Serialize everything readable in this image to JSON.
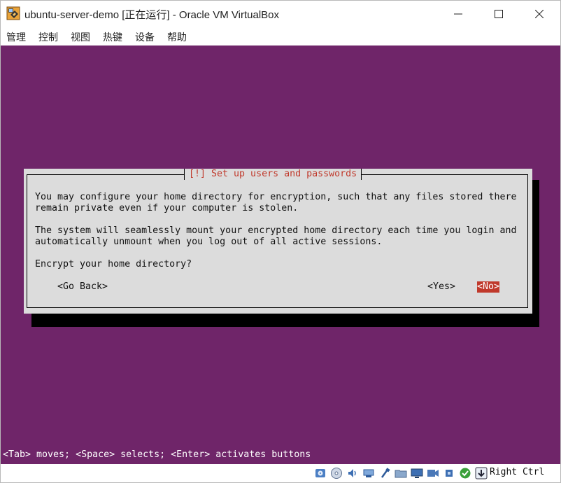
{
  "window": {
    "title": "ubuntu-server-demo [正在运行] - Oracle VM VirtualBox",
    "app_icon": "virtualbox-icon"
  },
  "menubar": {
    "items": [
      "管理",
      "控制",
      "视图",
      "热键",
      "设备",
      "帮助"
    ]
  },
  "installer": {
    "background_color": "#6f2569",
    "dialog_title": "[!] Set up users and passwords",
    "paragraph1_line1": "You may configure your home directory for encryption, such that any files stored there",
    "paragraph1_line2": "remain private even if your computer is stolen.",
    "paragraph2_line1": "The system will seamlessly mount your encrypted home directory each time you login and",
    "paragraph2_line2": "automatically unmount when you log out of all active sessions.",
    "question": "Encrypt your home directory?",
    "buttons": {
      "go_back": "<Go Back>",
      "yes": "<Yes>",
      "no": "<No>"
    },
    "selected_button": "no",
    "help_line": "<Tab> moves; <Space> selects; <Enter> activates buttons"
  },
  "statusbar": {
    "icons": [
      "hard-disk-icon",
      "optical-drive-icon",
      "audio-icon",
      "network-icon",
      "usb-icon",
      "shared-folder-icon",
      "display-icon",
      "video-capture-icon",
      "cpu-icon",
      "mouse-integration-icon",
      "host-key-arrow-icon"
    ],
    "host_key": "Right Ctrl"
  }
}
